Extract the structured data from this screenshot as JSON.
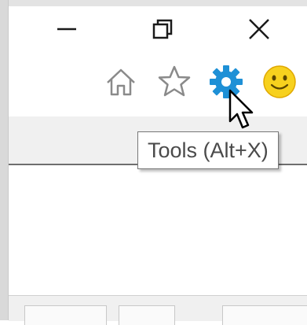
{
  "window": {
    "caption_buttons": [
      {
        "name": "minimize",
        "glyph": "—"
      },
      {
        "name": "restore",
        "glyph": "❐"
      },
      {
        "name": "close",
        "glyph": "✕"
      }
    ]
  },
  "toolbar": {
    "icons": [
      {
        "name": "home-icon",
        "color": "#8a8a8a"
      },
      {
        "name": "favorites-star-icon",
        "color": "#8a8a8a"
      },
      {
        "name": "tools-gear-icon",
        "color": "#1e90d6"
      },
      {
        "name": "feedback-smiley-icon",
        "color": "#f2c200"
      }
    ]
  },
  "tooltip": {
    "text": "Tools (Alt+X)"
  },
  "colors": {
    "frame": "#d9d9d9",
    "chrome": "#f0f0f0",
    "accent_blue": "#1e90d6",
    "smiley_yellow": "#f7d11e"
  }
}
